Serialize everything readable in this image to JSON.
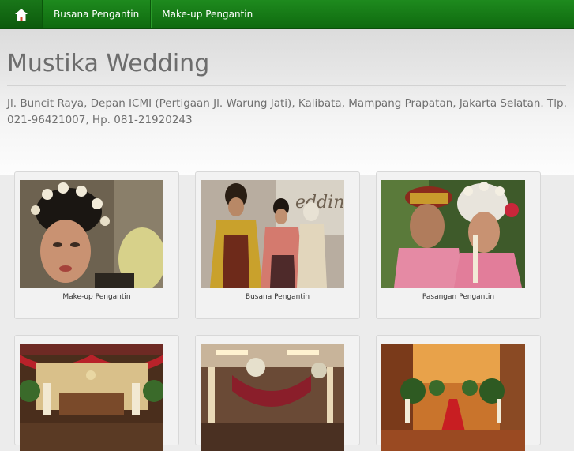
{
  "nav": {
    "home_icon": "home-icon",
    "items": [
      {
        "label": "Busana Pengantin"
      },
      {
        "label": "Make-up Pengantin"
      }
    ]
  },
  "header": {
    "title": "Mustika Wedding",
    "address": "Jl. Buncit Raya, Depan ICMI (Pertigaan Jl. Warung Jati), Kalibata, Mampang Prapatan, Jakarta Selatan. Tlp. 021-96421007, Hp. 081-21920243"
  },
  "gallery": [
    {
      "caption": "Make-up Pengantin"
    },
    {
      "caption": "Busana Pengantin"
    },
    {
      "caption": "Pasangan Pengantin"
    },
    {
      "caption": ""
    },
    {
      "caption": ""
    },
    {
      "caption": ""
    }
  ],
  "colors": {
    "nav_green": "#137a13",
    "title": "#6d6d6d"
  }
}
